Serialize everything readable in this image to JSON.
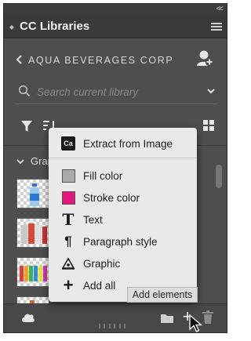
{
  "panel": {
    "title": "CC Libraries",
    "collapse_glyph": "<<"
  },
  "library": {
    "name": "AQUA BEVERAGES CORP"
  },
  "search": {
    "placeholder": "Search current library"
  },
  "group": {
    "label": "Grap"
  },
  "menu": {
    "items": [
      {
        "label": "Extract from Image",
        "icon": "ca-capture-icon",
        "badge": "Ca"
      },
      {
        "label": "Fill color",
        "icon": "fill-color-swatch-icon",
        "swatch": "#aaaaaa"
      },
      {
        "label": "Stroke color",
        "icon": "stroke-color-swatch-icon",
        "swatch": "#e6147f"
      },
      {
        "label": "Text",
        "icon": "text-icon",
        "glyph": "T"
      },
      {
        "label": "Paragraph style",
        "icon": "paragraph-style-icon",
        "glyph": "¶"
      },
      {
        "label": "Graphic",
        "icon": "graphic-pen-icon"
      },
      {
        "label": "Add all",
        "icon": "plus-icon",
        "glyph": "+"
      }
    ]
  },
  "tooltip": {
    "text": "Add elements"
  },
  "footer": {
    "add_glyph": "+"
  },
  "colors": {
    "panel_bg": "#4e4e4e",
    "menu_bg": "#e9e9e9",
    "stroke_swatch": "#e6147f",
    "fill_swatch": "#aaaaaa"
  }
}
